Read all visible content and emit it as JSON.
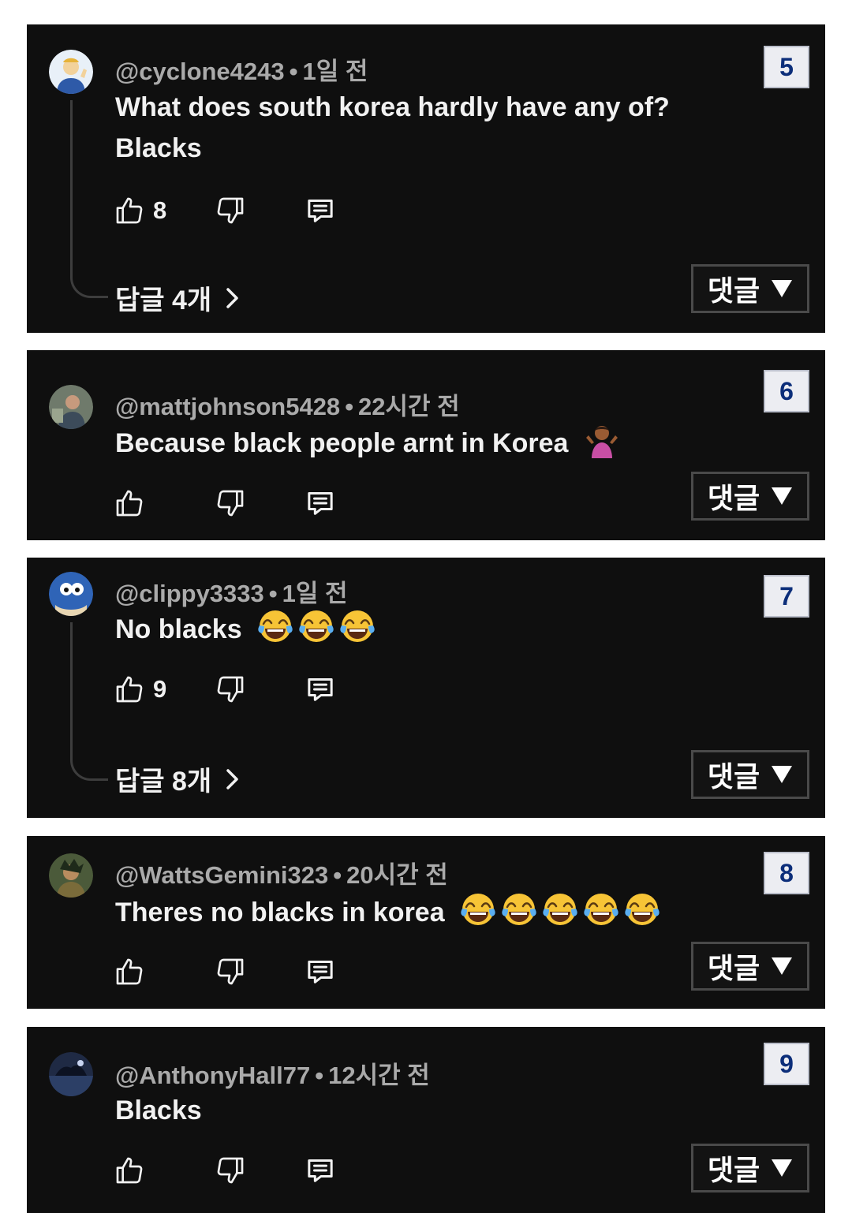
{
  "ui": {
    "reply_button_label": "댓글"
  },
  "comments": [
    {
      "number": "5",
      "username": "@cyclone4243",
      "time": "1일 전",
      "text_lines": [
        "What does south korea hardly have any of?",
        "Blacks"
      ],
      "likes": "8",
      "replies": "답글 4개"
    },
    {
      "number": "6",
      "username": "@mattjohnson5428",
      "time": "22시간 전",
      "text_lines": [
        "Because black people arnt in Korea"
      ],
      "emoji": "person-shrugging",
      "likes": "",
      "replies": ""
    },
    {
      "number": "7",
      "username": "@clippy3333",
      "time": "1일 전",
      "text_lines": [
        "No blacks"
      ],
      "emoji": "face-with-tears-of-joy x3",
      "likes": "9",
      "replies": "답글 8개"
    },
    {
      "number": "8",
      "username": "@WattsGemini323",
      "time": "20시간 전",
      "text_lines": [
        "Theres no blacks in korea"
      ],
      "emoji": "face-with-tears-of-joy x5",
      "likes": "",
      "replies": ""
    },
    {
      "number": "9",
      "username": "@AnthonyHall77",
      "time": "12시간 전",
      "text_lines": [
        "Blacks"
      ],
      "likes": "",
      "replies": ""
    }
  ]
}
